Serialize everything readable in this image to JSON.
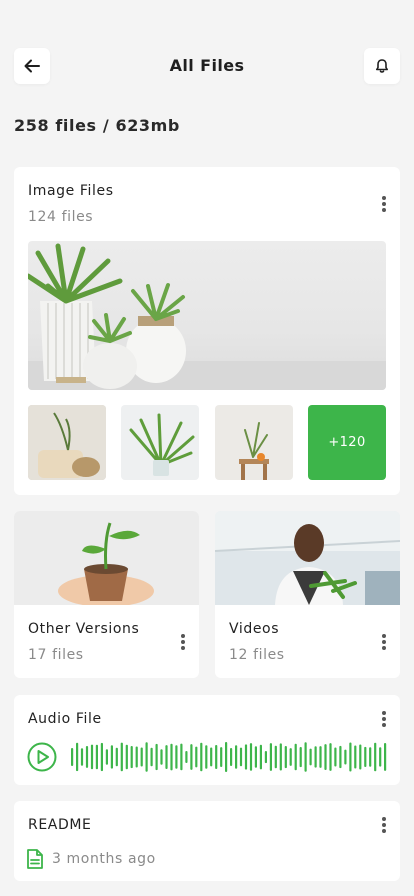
{
  "header": {
    "title": "All Files"
  },
  "summary": "258 files / 623mb",
  "image_files": {
    "title": "Image Files",
    "count": "124 files",
    "more_label": "+120"
  },
  "other_versions": {
    "title": "Other Versions",
    "count": "17 files"
  },
  "videos": {
    "title": "Videos",
    "count": "12 files"
  },
  "audio": {
    "title": "Audio File"
  },
  "readme": {
    "title": "README",
    "modified": "3 months ago"
  },
  "colors": {
    "accent": "#3db54a",
    "background": "#f4f4f4",
    "card": "#ffffff"
  }
}
